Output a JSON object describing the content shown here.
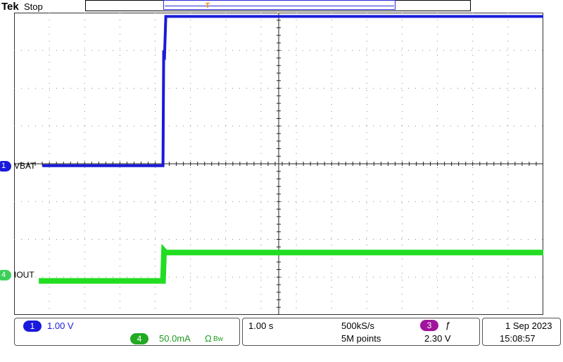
{
  "header": {
    "brand": "Tek",
    "acquisition_state": "Stop",
    "trigger_position_marker": "T"
  },
  "channels": {
    "ch1": {
      "number": "1",
      "label": "VBAT",
      "scale": "1.00 V",
      "color": "#1a1adc"
    },
    "ch4": {
      "number": "4",
      "label": "IOUT",
      "scale": "50.0mA",
      "color": "#22dd22",
      "coupling_icon": "Ω",
      "bw_icon": "Bw"
    }
  },
  "timebase": {
    "scale": "1.00 s",
    "sample_rate": "500kS/s",
    "record_length": "5M points"
  },
  "trigger": {
    "source": "3",
    "slope_icon": "ƒ",
    "level": "2.30 V",
    "color": "#a0149c"
  },
  "datetime": {
    "date": "1 Sep  2023",
    "time": "15:08:57"
  },
  "chart_data": {
    "type": "line",
    "x_unit_per_div": "1.00 s",
    "divisions": {
      "x": 15,
      "y": 8
    },
    "grid": true,
    "series": [
      {
        "name": "VBAT",
        "x_divs": [
          0.8,
          4.22,
          4.24,
          4.26,
          4.3,
          15
        ],
        "y_divs": [
          -0.05,
          -0.05,
          3.0,
          2.75,
          3.9,
          3.9
        ]
      },
      {
        "name": "IOUT",
        "x_divs": [
          0.7,
          4.22,
          4.25,
          4.3,
          15
        ],
        "y_divs": [
          -3.1,
          -3.1,
          -2.3,
          -2.35,
          -2.35
        ]
      }
    ]
  }
}
